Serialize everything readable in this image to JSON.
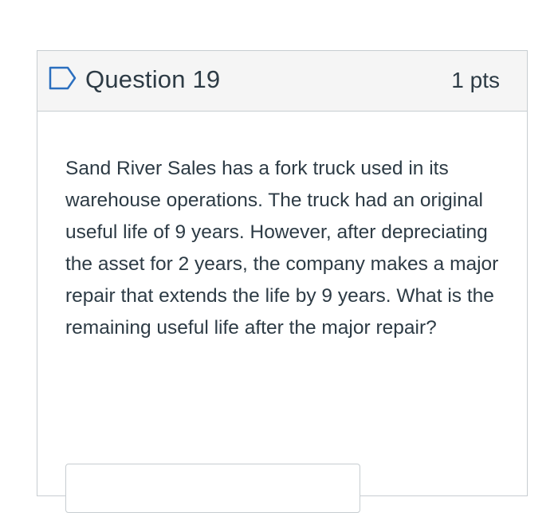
{
  "question": {
    "title": "Question 19",
    "points": "1 pts",
    "text": "Sand River Sales has a fork truck used in its warehouse operations. The truck had an original useful life of 9 years. However, after depreciating the asset for 2 years, the company makes a major repair that extends the life by 9 years. What is the remaining useful life after the major repair?",
    "flag_icon": "flag-icon",
    "answer_value": "",
    "accent_color": "#2b6fbf"
  }
}
